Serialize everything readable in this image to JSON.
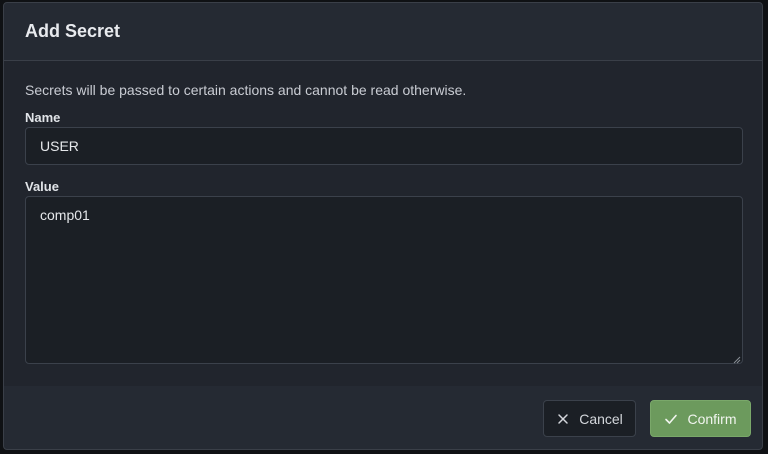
{
  "dialog": {
    "title": "Add Secret",
    "description": "Secrets will be passed to certain actions and cannot be read otherwise."
  },
  "fields": {
    "name": {
      "label": "Name",
      "value": "USER"
    },
    "value": {
      "label": "Value",
      "value": "comp01"
    }
  },
  "actions": {
    "cancel_label": "Cancel",
    "cancel_icon": "x-icon",
    "confirm_label": "Confirm",
    "confirm_icon": "check-icon"
  },
  "colors": {
    "confirm_accent": "#6c9a5d",
    "dialog_background": "#252a33",
    "input_background": "#1b1f25"
  }
}
